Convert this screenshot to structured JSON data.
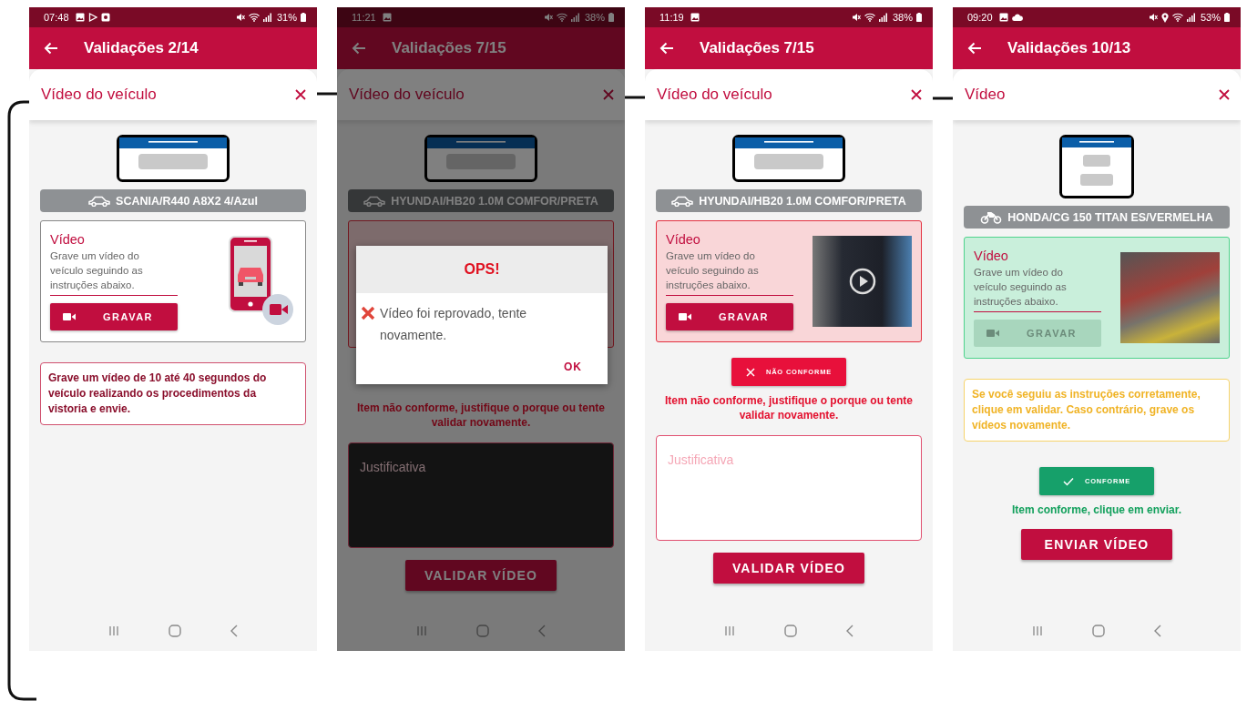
{
  "screens": [
    {
      "dimmed": false,
      "status_bar": {
        "time": "07:48",
        "left_icons": [
          {
            "kind": "image"
          },
          {
            "kind": "play"
          },
          {
            "kind": "record"
          }
        ],
        "right_icons": [
          {
            "kind": "mute"
          },
          {
            "kind": "wifi"
          },
          {
            "kind": "signal"
          }
        ],
        "battery": "31%"
      },
      "title": "Validações 2/14",
      "sheet_title": "Vídeo do veículo",
      "vehicle": {
        "kind": "car",
        "label": "SCANIA/R440 A8X2 4/Azul"
      },
      "card": {
        "rejected": false,
        "approved": false,
        "title": "Vídeo",
        "description": "Grave um vídeo do veículo seguindo as instruções abaixo.",
        "record_button": {
          "label": "GRAVAR",
          "disabled": false
        },
        "media": {
          "kind": "illustration"
        }
      },
      "items": [
        {
          "kind": "error_notice",
          "text": "Grave um vídeo de 10 até 40 segundos do veículo realizando os procedimentos da vistoria e envie."
        }
      ]
    },
    {
      "dimmed": true,
      "status_bar": {
        "time": "11:21",
        "left_icons": [
          {
            "kind": "image"
          }
        ],
        "right_icons": [
          {
            "kind": "mute"
          },
          {
            "kind": "wifi"
          },
          {
            "kind": "signal"
          }
        ],
        "battery": "38%"
      },
      "title": "Validações 7/15",
      "sheet_title": "Vídeo do veículo",
      "vehicle": {
        "kind": "car",
        "label": "HYUNDAI/HB20 1.0M COMFOR/PRETA"
      },
      "card": {
        "rejected": true,
        "approved": false
      },
      "dialog": {
        "title": "OPS!",
        "message": "Vídeo foi reprovado, tente novamente.",
        "button": "OK"
      },
      "items": [
        {
          "kind": "error_message",
          "text": "Item não conforme, justifique o porque ou tente validar novamente."
        },
        {
          "kind": "justification",
          "placeholder": "Justificativa"
        },
        {
          "kind": "submit",
          "label": "VALIDAR VÍDEO"
        }
      ]
    },
    {
      "dimmed": false,
      "status_bar": {
        "time": "11:19",
        "left_icons": [
          {
            "kind": "image"
          }
        ],
        "right_icons": [
          {
            "kind": "mute"
          },
          {
            "kind": "wifi"
          },
          {
            "kind": "signal"
          }
        ],
        "battery": "38%"
      },
      "title": "Validações 7/15",
      "sheet_title": "Vídeo do veículo",
      "vehicle": {
        "kind": "car",
        "label": "HYUNDAI/HB20 1.0M COMFOR/PRETA"
      },
      "card": {
        "rejected": true,
        "approved": false,
        "title": "Vídeo",
        "description": "Grave um vídeo do veículo seguindo as instruções abaixo.",
        "record_button": {
          "label": "GRAVAR",
          "disabled": false
        },
        "media": {
          "kind": "video"
        }
      },
      "items": [
        {
          "kind": "reject_verdict",
          "label": "NÃO CONFORME"
        },
        {
          "kind": "error_message",
          "text": "Item não conforme, justifique o porque ou tente validar novamente."
        },
        {
          "kind": "justification",
          "placeholder": "Justificativa"
        },
        {
          "kind": "submit",
          "label": "VALIDAR VÍDEO"
        }
      ]
    },
    {
      "dimmed": false,
      "status_bar": {
        "time": "09:20",
        "left_icons": [
          {
            "kind": "image"
          },
          {
            "kind": "cloud"
          }
        ],
        "right_icons": [
          {
            "kind": "mute"
          },
          {
            "kind": "location"
          },
          {
            "kind": "wifi"
          },
          {
            "kind": "signal"
          }
        ],
        "battery": "53%"
      },
      "title": "Validações 10/13",
      "sheet_title": "Vídeo",
      "vehicle": {
        "kind": "motorcycle",
        "label": "HONDA/CG 150 TITAN ES/VERMELHA"
      },
      "card": {
        "rejected": false,
        "approved": true,
        "title": "Vídeo",
        "description": "Grave um vídeo do veículo seguindo as instruções abaixo.",
        "record_button": {
          "label": "GRAVAR",
          "disabled": true
        },
        "media": {
          "kind": "photo"
        }
      },
      "items": [
        {
          "kind": "warning_notice",
          "text": "Se você seguiu as instruções corretamente, clique em validar. Caso contrário, grave os vídeos novamente."
        },
        {
          "kind": "accept_verdict",
          "label": "CONFORME"
        },
        {
          "kind": "success_message",
          "text": "Item conforme, clique em enviar."
        },
        {
          "kind": "submit",
          "label": "ENVIAR VÍDEO"
        }
      ]
    }
  ]
}
